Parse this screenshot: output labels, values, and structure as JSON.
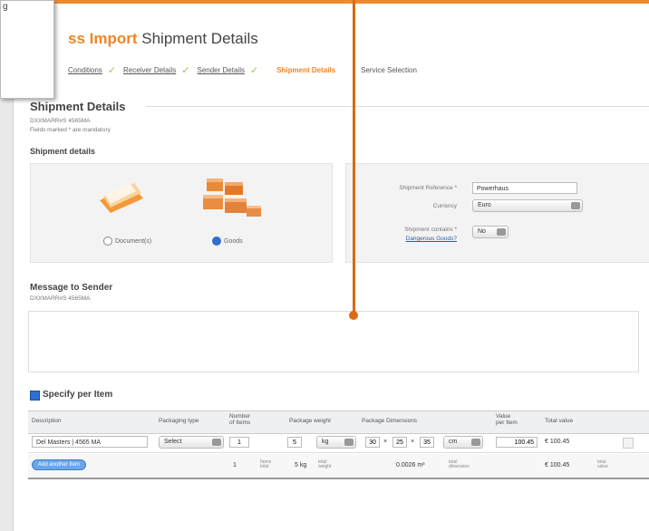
{
  "header": {
    "brand": "ss Import",
    "subtitle": "Shipment Details"
  },
  "steps": [
    {
      "label": "Conditions",
      "done": true
    },
    {
      "label": "Receiver Details",
      "done": true
    },
    {
      "label": "Sender Details",
      "done": true
    },
    {
      "label": "Shipment Details",
      "active": true
    },
    {
      "label": "Service Selection"
    }
  ],
  "shipment_section": {
    "title": "Shipment Details",
    "ref_line": "DXXMARR#S 4565MA",
    "mandatory_note": "Fields marked * are mandatory",
    "subheading": "Shipment details"
  },
  "type_options": {
    "documents_label": "Document(s)",
    "goods_label": "Goods",
    "selected": "Goods"
  },
  "details_form": {
    "reference_label": "Shipment Reference *",
    "reference_value": "Powerhaus",
    "currency_label": "Currency",
    "currency_value": "Euro",
    "dangerous_label": "Shipment contains *",
    "dangerous_link": "Dangerous Goods?",
    "dangerous_value": "No"
  },
  "message_section": {
    "title": "Message to Sender",
    "ref_line": "DXXMARR#S 4565MA"
  },
  "specify": {
    "checkbox_label": "Specify per Item",
    "checked": true
  },
  "table": {
    "headers": {
      "description": "Description",
      "packaging": "Packaging type",
      "items_line1": "Number",
      "items_line2": "of Items",
      "weight": "Package weight",
      "dimensions": "Package Dimensions",
      "value_line1": "Value",
      "value_line2": "per Item",
      "total": "Total value"
    },
    "row": {
      "description": "Del Masters | 4565 MA",
      "packaging": "Select",
      "items": "1",
      "weight": "5",
      "weight_unit": "kg",
      "dim_l": "30",
      "dim_w": "25",
      "dim_h": "35",
      "dim_unit": "cm",
      "value": "100.45",
      "total": "€ 100.45"
    },
    "totals": {
      "add_button": "Add another Item",
      "items": "1",
      "items_label_1": "Items",
      "items_label_2": "total",
      "weight": "5 kg",
      "weight_label_1": "total",
      "weight_label_2": "weight",
      "volume": "0.0026 m³",
      "volume_label_1": "total",
      "volume_label_2": "dimension",
      "value": "€ 100.45",
      "value_label_1": "total",
      "value_label_2": "value"
    }
  },
  "overlay": {
    "text": "g"
  },
  "colors": {
    "accent": "#ef8524",
    "pointer": "#d96a16",
    "check": "#9acb3c",
    "link_blue": "#2f6fcf"
  }
}
